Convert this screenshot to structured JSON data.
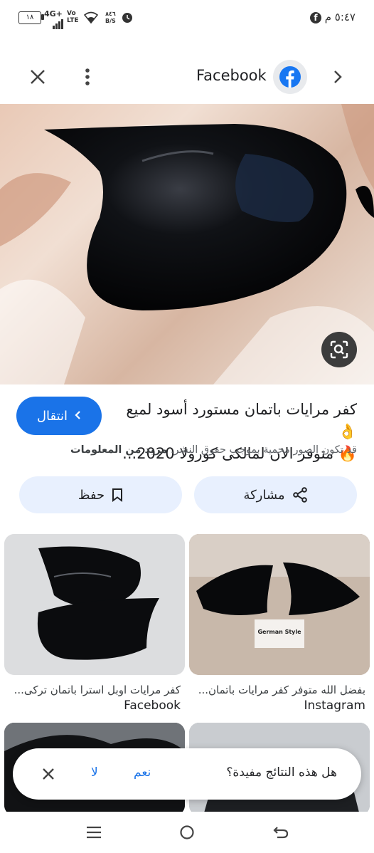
{
  "status_bar": {
    "time": "٥:٤٧ م",
    "battery": "١٨",
    "network": "4G+",
    "volte": "Vo LTE",
    "speed_value": "٨٤٦",
    "speed_unit": "B/S"
  },
  "top_bar": {
    "source_name": "Facebook",
    "icons": [
      "close-icon",
      "more-vert-icon",
      "facebook-icon",
      "chevron-right-icon"
    ]
  },
  "result": {
    "title_line1": "كفر مرايات باتمان مستورد أسود لميع 👌",
    "title_line2": "🔥 متوفر الان لمالكى كورولا 2020...",
    "visit_label": "انتقال",
    "copyright_text": "قد تكون الصور محمية بموجب حقوق النشر.",
    "more_info_label": "مزيد من المعلومات",
    "share_label": "مشاركة",
    "save_label": "حفظ"
  },
  "related": [
    {
      "caption": "بفضل الله متوفر كفر مرايات باتمان...",
      "source": "Instagram"
    },
    {
      "caption": "كفر مرايات اوبل استرا باتمان تركى...",
      "source": "Facebook"
    }
  ],
  "thumb_watermark": "German Style",
  "feedback": {
    "question": "هل هذه النتائج مفيدة؟",
    "yes_label": "نعم",
    "no_label": "لا"
  },
  "colors": {
    "accent": "#1a73e8",
    "button_bg": "#e8f0fe",
    "facebook_blue": "#1877f2"
  }
}
